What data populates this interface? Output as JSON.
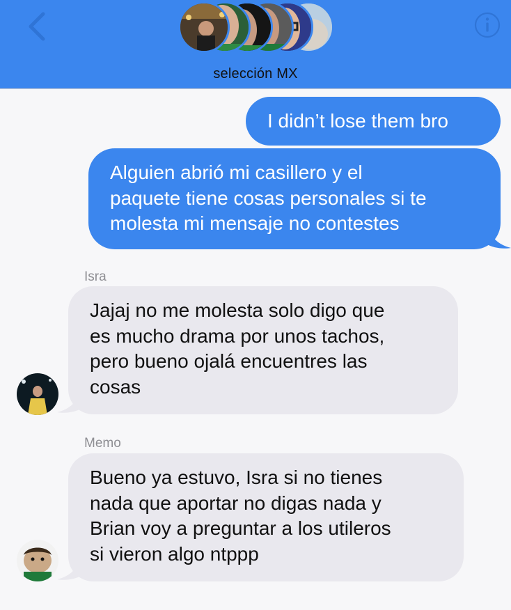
{
  "header": {
    "title": "selección MX",
    "back_icon": "chevron-left-icon",
    "info_icon": "info-circle-icon"
  },
  "messages": [
    {
      "direction": "outgoing",
      "lines": [
        "I didn’t lose them bro"
      ]
    },
    {
      "direction": "outgoing",
      "lines": [
        "Alguien abrió mi casillero y el",
        "paquete tiene cosas personales si te",
        "molesta mi mensaje no contestes"
      ]
    },
    {
      "direction": "incoming",
      "sender": "Isra",
      "lines": [
        "Jajaj no me molesta solo digo que",
        "es mucho drama por unos tachos,",
        "pero bueno ojalá encuentres las",
        "cosas"
      ]
    },
    {
      "direction": "incoming",
      "sender": "Memo",
      "lines": [
        "Bueno ya estuvo, Isra si no tienes",
        "nada que aportar no digas nada y",
        "Brian voy a preguntar a los utileros",
        "si vieron algo ntppp"
      ]
    }
  ],
  "colors": {
    "header_bg": "#3b86ee",
    "outgoing_bubble": "#3b86ee",
    "incoming_bubble": "#e9e8ee",
    "background": "#f7f7f9"
  }
}
